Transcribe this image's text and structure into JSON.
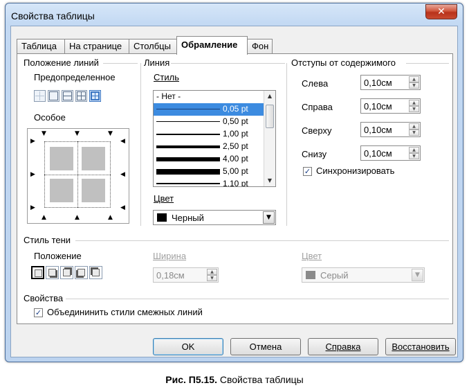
{
  "window": {
    "title": "Свойства таблицы",
    "close_glyph": "✕"
  },
  "tabs": [
    {
      "label": "Таблица",
      "active": false
    },
    {
      "label": "На странице",
      "active": false
    },
    {
      "label": "Столбцы",
      "active": false
    },
    {
      "label": "Обрамление",
      "active": true
    },
    {
      "label": "Фон",
      "active": false
    }
  ],
  "line_arrangement": {
    "title": "Положение линий",
    "predefined_label": "Предопределенное",
    "custom_label": "Особое"
  },
  "line": {
    "title": "Линия",
    "style_label": "Стиль",
    "styles": [
      {
        "label": "- Нет -",
        "thickness": 0,
        "selected": false
      },
      {
        "label": "0,05 pt",
        "thickness": 1,
        "selected": true
      },
      {
        "label": "0,50 pt",
        "thickness": 2,
        "selected": false
      },
      {
        "label": "1,00 pt",
        "thickness": 3,
        "selected": false
      },
      {
        "label": "2,50 pt",
        "thickness": 4,
        "selected": false
      },
      {
        "label": "4,00 pt",
        "thickness": 5,
        "selected": false
      },
      {
        "label": "5,00 pt",
        "thickness": 6,
        "selected": false
      },
      {
        "label": "1,10 pt",
        "thickness": 3,
        "selected": false
      }
    ],
    "color_label": "Цвет",
    "color_value": "Черный",
    "color_hex": "#000000"
  },
  "spacing": {
    "title": "Отступы от содержимого",
    "fields": [
      {
        "label": "Слева",
        "value": "0,10см"
      },
      {
        "label": "Справа",
        "value": "0,10см"
      },
      {
        "label": "Сверху",
        "value": "0,10см"
      },
      {
        "label": "Снизу",
        "value": "0,10см"
      }
    ],
    "sync_label": "Синхронизировать",
    "sync_checked": true
  },
  "shadow": {
    "title": "Стиль тени",
    "position_label": "Положение",
    "width_label": "Ширина",
    "width_value": "0,18см",
    "color_label": "Цвет",
    "color_value": "Серый",
    "color_hex": "#8a8a8a"
  },
  "properties": {
    "title": "Свойства",
    "merge_label": "Объедининить стили смежных линий",
    "merge_checked": true
  },
  "buttons": {
    "ok": "OK",
    "cancel": "Отмена",
    "help": "Справка",
    "reset": "Восстановить"
  },
  "caption": {
    "prefix": "Рис. П5.15.",
    "text": " Свойства таблицы"
  },
  "icons": {
    "check": "✓",
    "dropdown": "▼",
    "spin_up": "▲",
    "spin_down": "▼"
  }
}
